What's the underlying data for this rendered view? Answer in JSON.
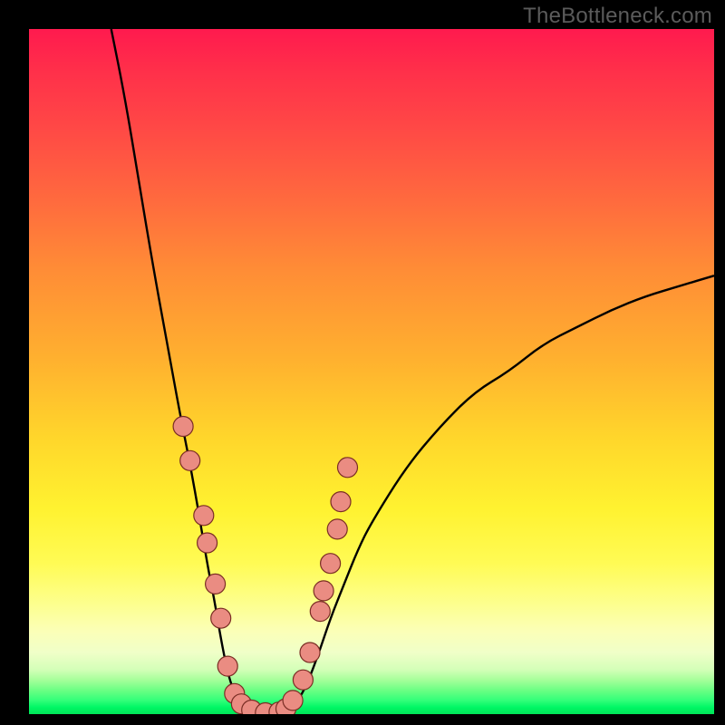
{
  "watermark": "TheBottleneck.com",
  "chart_data": {
    "type": "line",
    "title": "",
    "xlabel": "",
    "ylabel": "",
    "xlim": [
      0,
      100
    ],
    "ylim": [
      0,
      100
    ],
    "grid": false,
    "legend": false,
    "curve_note": "Asymmetric V-shaped bottleneck curve; minimum near x≈30, y≈0. Left branch x≈12→30 falling from y≈100 to 0; right branch x≈30→100 rising from y≈0 to ≈64.",
    "series": [
      {
        "name": "curve-left",
        "x": [
          12,
          14,
          16,
          18,
          20,
          22,
          24,
          26,
          27,
          28,
          29,
          30,
          31,
          32,
          33,
          34,
          36
        ],
        "y": [
          100,
          90,
          78,
          66,
          55,
          44,
          34,
          22,
          17,
          11,
          6,
          3,
          1,
          0.5,
          0.2,
          0.1,
          0
        ]
      },
      {
        "name": "curve-right",
        "x": [
          36,
          38,
          40,
          42,
          44,
          46,
          48,
          50,
          55,
          60,
          65,
          70,
          75,
          80,
          85,
          90,
          95,
          100
        ],
        "y": [
          0,
          0.5,
          3,
          8,
          14,
          19,
          24,
          28,
          36,
          42,
          47,
          50,
          54,
          56.5,
          59,
          61,
          62.5,
          64
        ]
      }
    ],
    "points": [
      {
        "x": 22.5,
        "y": 42
      },
      {
        "x": 23.5,
        "y": 37
      },
      {
        "x": 25.5,
        "y": 29
      },
      {
        "x": 26.0,
        "y": 25
      },
      {
        "x": 27.2,
        "y": 19
      },
      {
        "x": 28.0,
        "y": 14
      },
      {
        "x": 29.0,
        "y": 7
      },
      {
        "x": 30.0,
        "y": 3
      },
      {
        "x": 31.0,
        "y": 1.5
      },
      {
        "x": 32.5,
        "y": 0.6
      },
      {
        "x": 34.5,
        "y": 0.2
      },
      {
        "x": 36.5,
        "y": 0.3
      },
      {
        "x": 37.5,
        "y": 0.8
      },
      {
        "x": 38.5,
        "y": 2
      },
      {
        "x": 40.0,
        "y": 5
      },
      {
        "x": 41.0,
        "y": 9
      },
      {
        "x": 42.5,
        "y": 15
      },
      {
        "x": 43.0,
        "y": 18
      },
      {
        "x": 44.0,
        "y": 22
      },
      {
        "x": 45.0,
        "y": 27
      },
      {
        "x": 45.5,
        "y": 31
      },
      {
        "x": 46.5,
        "y": 36
      }
    ],
    "dot_radius_px": 11
  }
}
